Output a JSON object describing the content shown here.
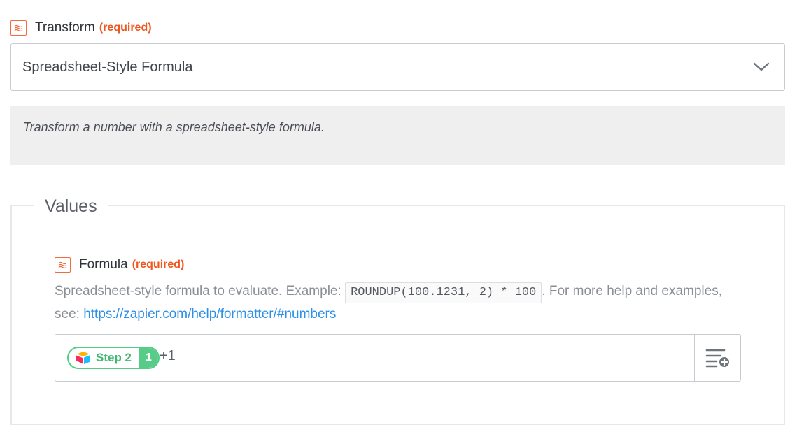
{
  "transform": {
    "label": "Transform",
    "required": "(required)",
    "selected_value": "Spreadsheet-Style Formula",
    "help_text": "Transform a number with a spreadsheet-style formula."
  },
  "values": {
    "legend": "Values",
    "formula": {
      "label": "Formula",
      "required": "(required)",
      "description_prefix": "Spreadsheet-style formula to evaluate. Example:",
      "code_example": "ROUNDUP(100.1231, 2) * 100",
      "description_mid": ". For more help and examples, see:",
      "help_link": "https://zapier.com/help/formatter/#numbers",
      "token": {
        "step_label": "Step 2",
        "count": "1",
        "app_icon": "airtable-icon"
      },
      "suffix_text": "+1"
    }
  },
  "icons": {
    "field_icon": "required-field-icon",
    "dropdown": "chevron-down-icon",
    "insert": "insert-data-icon"
  },
  "colors": {
    "required": "#f0571f",
    "link": "#2c8fe8",
    "token_green": "#57cc89"
  }
}
